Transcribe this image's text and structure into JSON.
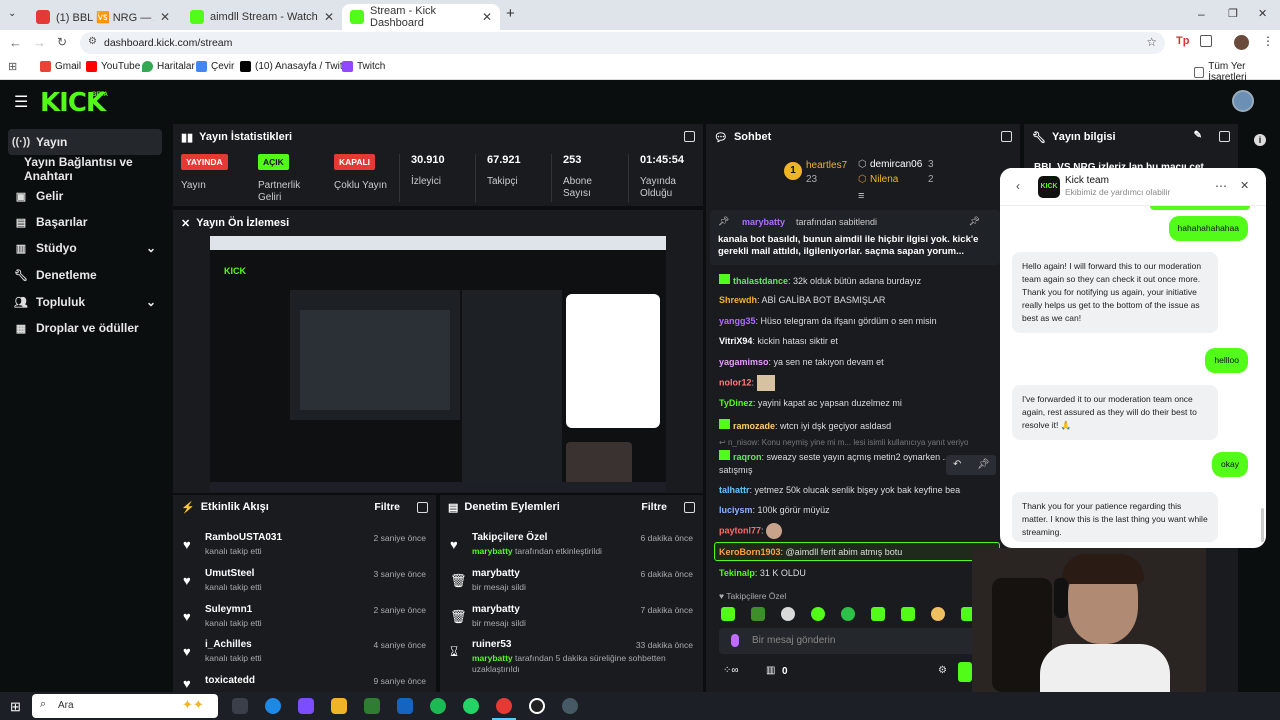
{
  "browser": {
    "tabs": [
      {
        "label": "(1) BBL 🆚 NRG — AG 🆚 G2 |",
        "color": "#e53935"
      },
      {
        "label": "aimdll Stream - Watch Live on",
        "color": "#53fc18"
      },
      {
        "label": "Stream - Kick Dashboard",
        "color": "#53fc18"
      }
    ],
    "new_tab": "+",
    "url": "dashboard.kick.com/stream",
    "bookmarks": [
      "Gmail",
      "YouTube",
      "Haritalar",
      "Çevir",
      "(10) Anasayfa / Twit...",
      "Twitch"
    ],
    "bookmarks_right": "Tüm Yer İşaretleri"
  },
  "brand": {
    "logo": "KICK",
    "beta": "BETA",
    "accent": "#53fc18"
  },
  "sidebar": {
    "items": [
      {
        "label": "Yayın",
        "icon": "broadcast-icon"
      },
      {
        "label": "Yayın Bağlantısı ve Anahtarı",
        "icon": ""
      },
      {
        "label": "Gelir",
        "icon": "money-icon"
      },
      {
        "label": "Başarılar",
        "icon": "trophy-icon"
      },
      {
        "label": "Stüdyo",
        "icon": "studio-icon"
      },
      {
        "label": "Denetleme",
        "icon": "wrench-icon"
      },
      {
        "label": "Topluluk",
        "icon": "community-icon"
      },
      {
        "label": "Droplar ve ödüller",
        "icon": "gift-icon"
      }
    ]
  },
  "stats": {
    "title": "Yayın İstatistikleri",
    "items": [
      {
        "badge": "YAYINDA",
        "label": "Yayın"
      },
      {
        "badge": "AÇIK",
        "label": "Partnerlik Geliri"
      },
      {
        "badge": "KAPALI",
        "label": "Çoklu Yayın"
      },
      {
        "num": "30.910",
        "label": "İzleyici"
      },
      {
        "num": "67.921",
        "label": "Takipçi"
      },
      {
        "num": "253",
        "label": "Abone Sayısı"
      },
      {
        "num": "01:45:54",
        "label": "Yayında Olduğu"
      }
    ]
  },
  "preview": {
    "title": "Yayın Ön İzlemesi"
  },
  "activity": {
    "title": "Etkinlik Akışı",
    "filter": "Filtre",
    "items": [
      {
        "who": "RamboUSTA031",
        "sub": "kanalı takip etti",
        "time": "2 saniye önce"
      },
      {
        "who": "UmutSteel",
        "sub": "kanalı takip etti",
        "time": "3 saniye önce"
      },
      {
        "who": "Suleymn1",
        "sub": "kanalı takip etti",
        "time": "2 saniye önce"
      },
      {
        "who": "i_Achilles",
        "sub": "kanalı takip etti",
        "time": "4 saniye önce"
      },
      {
        "who": "toxicatedd",
        "sub": "",
        "time": "9 saniye önce"
      }
    ]
  },
  "moderation": {
    "title": "Denetim Eylemleri",
    "filter": "Filtre",
    "items": [
      {
        "icon": "heart-icon",
        "who": "Takipçilere Özel",
        "actor": "marybatty",
        "sub": " tarafından etkinleştirildi",
        "time": "6 dakika önce"
      },
      {
        "icon": "trash-icon",
        "who": "marybatty",
        "actor": "",
        "sub": "bir mesajı sildi",
        "time": "6 dakika önce"
      },
      {
        "icon": "trash-icon",
        "who": "marybatty",
        "actor": "",
        "sub": "bir mesajı sildi",
        "time": "7 dakika önce"
      },
      {
        "icon": "hourglass-icon",
        "who": "ruiner53",
        "actor": "marybatty",
        "sub": " tarafından 5 dakika süreliğine sohbetten uzaklaştırıldı",
        "time": "33 dakika önce"
      }
    ]
  },
  "chat": {
    "title": "Sohbet",
    "top_gifters": [
      {
        "rank": "1",
        "name": "heartles7",
        "count": "23"
      },
      {
        "rank": "",
        "name": "demircan06",
        "count": "3"
      },
      {
        "rank": "",
        "name": "Nilena",
        "count": "2"
      }
    ],
    "pinned_by": "marybatty",
    "pinned_suffix": "tarafından sabitlendi",
    "pinned_text": "kanala bot basıldı, bunun aimdil ile hiçbir ilgisi yok. kick'e gerekli mail attıldı, ilgileniyorlar. saçma sapan yorum...",
    "messages": [
      {
        "user": "thalastdance",
        "color": "#6be36b",
        "text": "32k olduk bütün adana burdayız"
      },
      {
        "user": "Shrewdh",
        "color": "#f0b429",
        "text": "ABİ GALİBA BOT BASMIŞLAR"
      },
      {
        "user": "yangg35",
        "color": "#b36bff",
        "text": "Hüso telegram da ifşanı gördüm o sen misin"
      },
      {
        "user": "VitriX94",
        "color": "#ffffff",
        "text": "kickin hatası siktir et"
      },
      {
        "user": "yagamimso",
        "color": "#e89cff",
        "text": "ya sen ne takıyon devam et"
      },
      {
        "user": "nolor12",
        "color": "#ff7b7b",
        "text": ""
      },
      {
        "user": "TyDinez",
        "color": "#53fc18",
        "text": "yayini kapat ac yapsan duzelmez mi"
      },
      {
        "user": "ramozade",
        "color": "#ffd166",
        "text": "wtcn iyi dşk geçiyor asldasd"
      },
      {
        "user": "n_nisow",
        "color": "#888",
        "text": "Konu neymiş yine mi m... lesi isimli kullanıcıya yanıt veriyo"
      },
      {
        "user": "raqron",
        "color": "#6be36b",
        "text": "sweazy seste yayın açmış metin2 oynarken ... satışmış"
      },
      {
        "user": "talhattr",
        "color": "#5cc8ff",
        "text": "yetmez 50k olucak senlik bişey yok bak keyfine bea"
      },
      {
        "user": "luciysm",
        "color": "#8ab4ff",
        "text": "100k görür müyüz"
      },
      {
        "user": "paytonl77",
        "color": "#ff6b6b",
        "text": ""
      },
      {
        "user": "KeroBorn1903",
        "color": "#ff9f43",
        "text": "@aimdll ferit abim atmış botu"
      },
      {
        "user": "Tekinalp",
        "color": "#53fc18",
        "text": "31 K OLDU"
      }
    ],
    "followers_only": "Takipçilere Özel",
    "input_placeholder": "Bir mesaj gönderin",
    "points": "0"
  },
  "streaminfo": {
    "title": "Yayın bilgisi",
    "preview": "BBL VS NRG izleriz lan bu maçıı cet"
  },
  "support": {
    "name": "Kick team",
    "subtitle": "Ekibimiz de yardımcı olabilir",
    "messages": [
      {
        "from": "me",
        "text": "hahahahahahaa"
      },
      {
        "from": "them",
        "text": "Hello again! I will forward this to our moderation team again so they can check it out once more. Thank you for notifying us again, your initiative really helps us get to the bottom of the issue as best as we can!"
      },
      {
        "from": "me",
        "text": "hellloo"
      },
      {
        "from": "them",
        "text": "I've forwarded it to our moderation team once again, rest assured as they will do their best to resolve it! 🙏"
      },
      {
        "from": "me",
        "text": "okay"
      },
      {
        "from": "them",
        "text": "Thank you for your patience regarding this matter. I know this is the last thing you want while streaming."
      }
    ]
  },
  "taskbar": {
    "search": "Ara"
  }
}
